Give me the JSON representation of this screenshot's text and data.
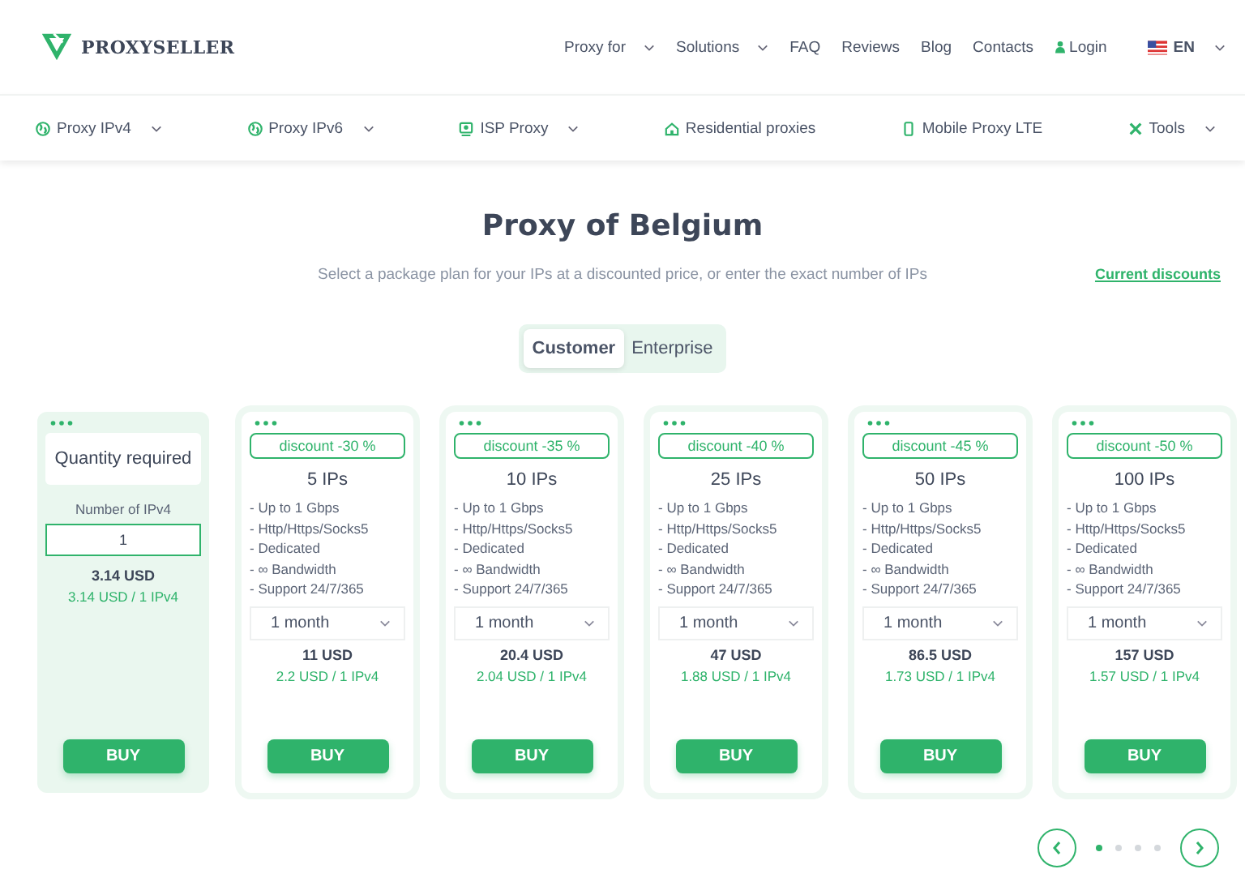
{
  "header": {
    "logo": "PROXYSELLER",
    "menu": [
      {
        "label": "Proxy for",
        "dropdown": true,
        "kind": "link"
      },
      {
        "label": "Solutions",
        "dropdown": true,
        "kind": "link"
      },
      {
        "label": "FAQ",
        "dropdown": false,
        "kind": "link"
      },
      {
        "label": "Reviews",
        "dropdown": false,
        "kind": "link"
      },
      {
        "label": "Blog",
        "dropdown": false,
        "kind": "link"
      },
      {
        "label": "Contacts",
        "dropdown": false,
        "kind": "link"
      },
      {
        "label": "Login",
        "dropdown": false,
        "kind": "login"
      },
      {
        "label": "EN",
        "dropdown": true,
        "kind": "language"
      }
    ]
  },
  "products_nav": [
    {
      "label": "Proxy IPv4",
      "dropdown": true
    },
    {
      "label": "Proxy IPv6",
      "dropdown": true
    },
    {
      "label": "ISP Proxy",
      "dropdown": true
    },
    {
      "label": "Residential proxies",
      "dropdown": false
    },
    {
      "label": "Mobile Proxy LTE",
      "dropdown": false
    },
    {
      "label": "Tools",
      "dropdown": true
    }
  ],
  "title": "Proxy of Belgium",
  "subtitle": "Select a package plan for your IPs at a discounted price, or enter the exact number of IPs",
  "discounts_link": "Current discounts",
  "tabs": [
    {
      "label": "Customer",
      "selected": true
    },
    {
      "label": "Enterprise",
      "selected": false
    }
  ],
  "cards": [
    {
      "kind": "custom",
      "heading": "Quantity required",
      "field_label": "Number of IPv4",
      "value": "1",
      "price": "3.14 USD",
      "unit_price": "3.14 USD / 1 IPv4",
      "button": "BUY"
    },
    {
      "kind": "package",
      "discount": "discount -30 %",
      "heading": "5 IPs",
      "features": [
        "- Up to 1 Gbps",
        "- Http/Https/Socks5",
        "- Dedicated",
        "- ∞ Bandwidth",
        "- Support 24/7/365"
      ],
      "period": "1 month",
      "price": "11 USD",
      "unit_price": "2.2 USD / 1 IPv4",
      "button": "BUY"
    },
    {
      "kind": "package",
      "discount": "discount -35 %",
      "heading": "10 IPs",
      "features": [
        "- Up to 1 Gbps",
        "- Http/Https/Socks5",
        "- Dedicated",
        "- ∞ Bandwidth",
        "- Support 24/7/365"
      ],
      "period": "1 month",
      "price": "20.4 USD",
      "unit_price": "2.04 USD / 1 IPv4",
      "button": "BUY"
    },
    {
      "kind": "package",
      "discount": "discount -40 %",
      "heading": "25 IPs",
      "features": [
        "- Up to 1 Gbps",
        "- Http/Https/Socks5",
        "- Dedicated",
        "- ∞ Bandwidth",
        "- Support 24/7/365"
      ],
      "period": "1 month",
      "price": "47 USD",
      "unit_price": "1.88 USD / 1 IPv4",
      "button": "BUY"
    },
    {
      "kind": "package",
      "discount": "discount -45 %",
      "heading": "50 IPs",
      "features": [
        "- Up to 1 Gbps",
        "- Http/Https/Socks5",
        "- Dedicated",
        "- ∞ Bandwidth",
        "- Support 24/7/365"
      ],
      "period": "1 month",
      "price": "86.5 USD",
      "unit_price": "1.73 USD / 1 IPv4",
      "button": "BUY"
    },
    {
      "kind": "package",
      "discount": "discount -50 %",
      "heading": "100 IPs",
      "features": [
        "- Up to 1 Gbps",
        "- Http/Https/Socks5",
        "- Dedicated",
        "- ∞ Bandwidth",
        "- Support 24/7/365"
      ],
      "period": "1 month",
      "price": "157 USD",
      "unit_price": "1.57 USD / 1 IPv4",
      "button": "BUY"
    }
  ],
  "pager": [
    {
      "selected": true
    },
    {
      "selected": false
    },
    {
      "selected": false
    },
    {
      "selected": false
    }
  ]
}
